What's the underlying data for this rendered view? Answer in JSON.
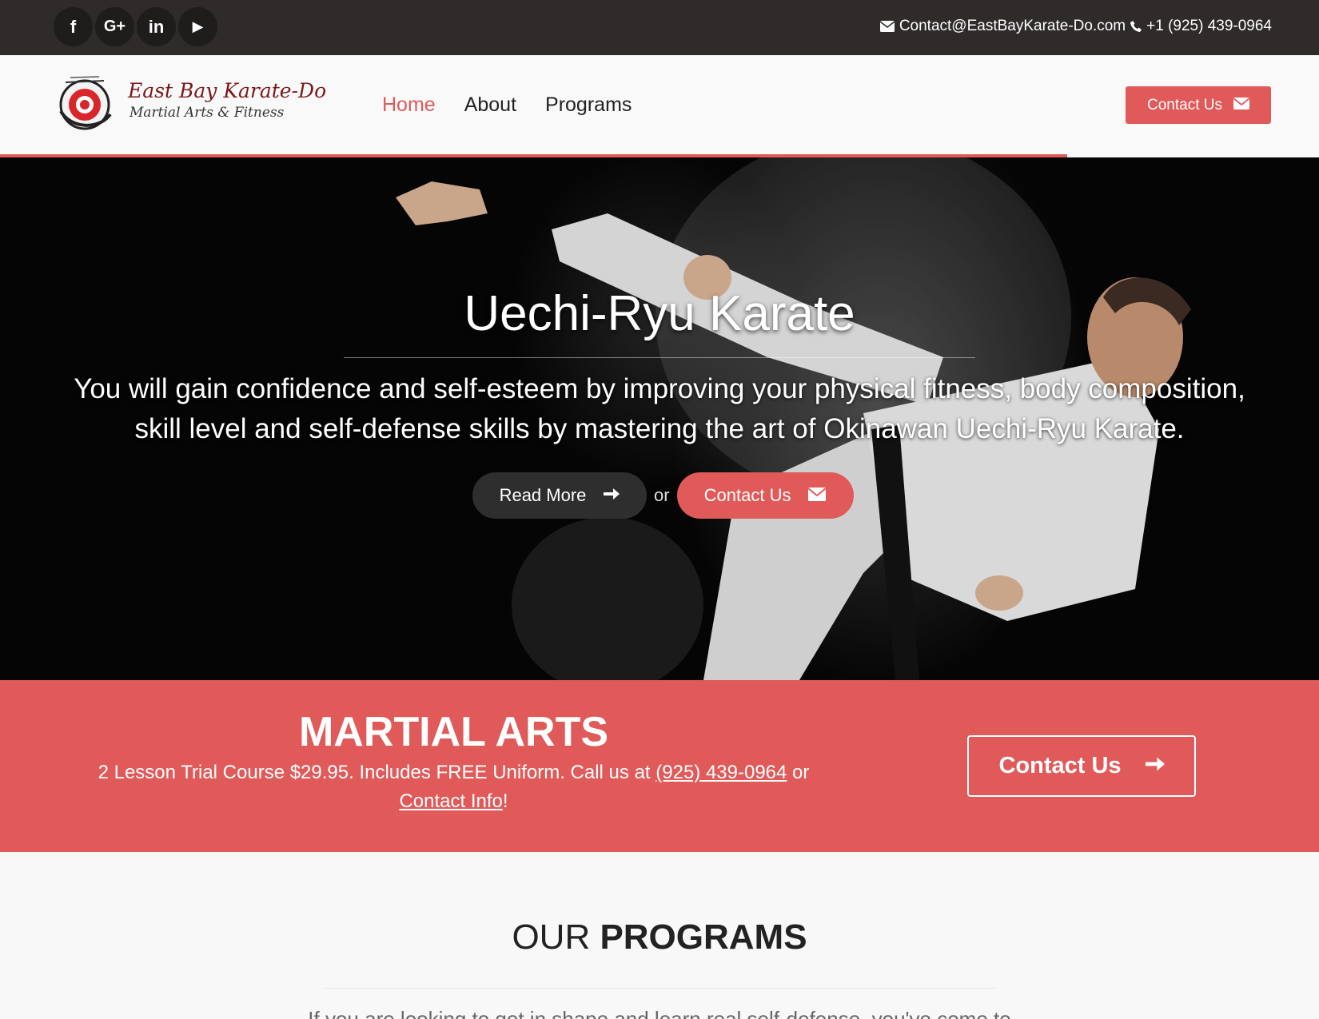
{
  "topbar": {
    "social": [
      {
        "icon": "facebook-icon",
        "glyph": "f"
      },
      {
        "icon": "google-plus-icon",
        "glyph": "G+"
      },
      {
        "icon": "linkedin-icon",
        "glyph": "in"
      },
      {
        "icon": "youtube-icon",
        "glyph": "▶"
      }
    ],
    "email": "Contact@EastBayKarate-Do.com",
    "phone": "+1 (925) 439-0964"
  },
  "nav": {
    "brand_title": "East Bay Karate-Do",
    "brand_subtitle": "Martial Arts & Fitness",
    "links": [
      "Home",
      "About",
      "Programs"
    ],
    "active_link": "Home",
    "cta_label": "Contact Us"
  },
  "hero": {
    "title": "Uechi-Ryu Karate",
    "text": "You will gain confidence and self-esteem by improving your physical fitness, body composition, skill level and self-defense skills by mastering the art of Okinawan Uechi-Ryu Karate.",
    "read_more_label": "Read More",
    "or_label": "or",
    "contact_label": "Contact Us"
  },
  "promo": {
    "title": "MARTIAL ARTS",
    "text_before": "2 Lesson Trial Course $29.95. Includes FREE Uniform. Call us at ",
    "phone_link": "(925) 439-0964",
    "text_middle": " or ",
    "contact_link": "Contact Info",
    "text_after": "!",
    "cta_label": "Contact Us"
  },
  "programs": {
    "title_light": "OUR ",
    "title_bold": "PROGRAMS",
    "intro": "If you are looking to get in shape and learn real self-defense, you've come to"
  },
  "colors": {
    "accent": "#e05a5a",
    "topbar_bg": "#2f2b2b",
    "hero_bg": "#050505"
  }
}
